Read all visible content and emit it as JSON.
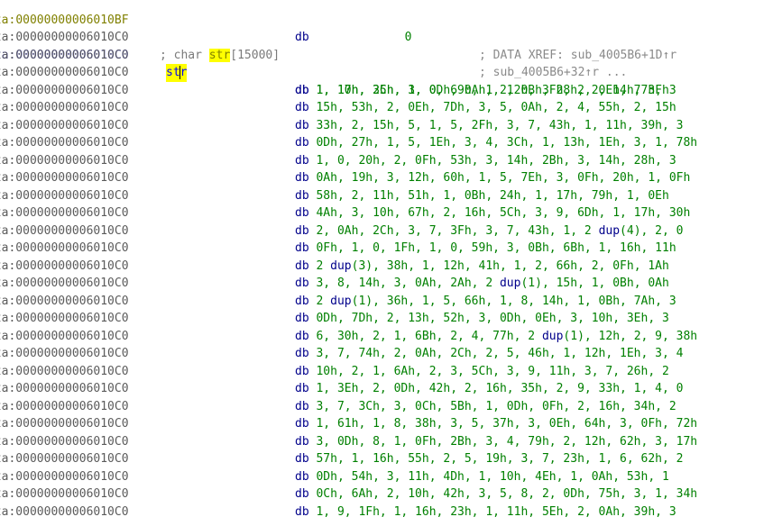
{
  "prefix": "ata:",
  "top_line": {
    "address": "00000000006010BF",
    "mnemonic": "db",
    "operands": "0"
  },
  "comment_line": {
    "address": "00000000006010C0",
    "pre": "; char ",
    "highlight": "str",
    "post": "[15000]"
  },
  "label_line": {
    "address": "00000000006010C0",
    "label_part1": "st",
    "label_part2": "r",
    "mnemonic": "db",
    "operands": "1, 10h, 25h, 3, 0Dh, 0Ah, 2, 0Bh, 28h, 2, 14h, 3Fh"
  },
  "xref_lines": [
    {
      "address": "00000000006010C0",
      "text": "; DATA XREF: sub_4005B6+1D↑r"
    },
    {
      "address": "00000000006010C0",
      "text": "; sub_4005B6+32↑r ..."
    }
  ],
  "data_lines": [
    {
      "address": "00000000006010C0",
      "mnemonic": "db",
      "operands": "1, 17h, 3Ch, 1, 0, 69h, 1, 12h, 3Fh, 2, 0Eh, 77h, 3"
    },
    {
      "address": "00000000006010C0",
      "mnemonic": "db",
      "operands": "15h, 53h, 2, 0Eh, 7Dh, 3, 5, 0Ah, 2, 4, 55h, 2, 15h"
    },
    {
      "address": "00000000006010C0",
      "mnemonic": "db",
      "operands": "33h, 2, 15h, 5, 1, 5, 2Fh, 3, 7, 43h, 1, 11h, 39h, 3"
    },
    {
      "address": "00000000006010C0",
      "mnemonic": "db",
      "operands": "0Dh, 27h, 1, 5, 1Eh, 3, 4, 3Ch, 1, 13h, 1Eh, 3, 1, 78h"
    },
    {
      "address": "00000000006010C0",
      "mnemonic": "db",
      "operands": "1, 0, 20h, 2, 0Fh, 53h, 3, 14h, 2Bh, 3, 14h, 28h, 3"
    },
    {
      "address": "00000000006010C0",
      "mnemonic": "db",
      "operands": "0Ah, 19h, 3, 12h, 60h, 1, 5, 7Eh, 3, 0Fh, 20h, 1, 0Fh"
    },
    {
      "address": "00000000006010C0",
      "mnemonic": "db",
      "operands": "58h, 2, 11h, 51h, 1, 0Bh, 24h, 1, 17h, 79h, 1, 0Eh"
    },
    {
      "address": "00000000006010C0",
      "mnemonic": "db",
      "operands": "4Ah, 3, 10h, 67h, 2, 16h, 5Ch, 3, 9, 6Dh, 1, 17h, 30h"
    },
    {
      "address": "00000000006010C0",
      "mnemonic": "db",
      "operands": "2, 0Ah, 2Ch, 3, 7, 3Fh, 3, 7, 43h, 1, 2 dup(4), 2, 0"
    },
    {
      "address": "00000000006010C0",
      "mnemonic": "db",
      "operands": "0Fh, 1, 0, 1Fh, 1, 0, 59h, 3, 0Bh, 6Bh, 1, 16h, 11h"
    },
    {
      "address": "00000000006010C0",
      "mnemonic": "db",
      "operands": "2 dup(3), 38h, 1, 12h, 41h, 1, 2, 66h, 2, 0Fh, 1Ah"
    },
    {
      "address": "00000000006010C0",
      "mnemonic": "db",
      "operands": "3, 8, 14h, 3, 0Ah, 2Ah, 2 dup(1), 15h, 1, 0Bh, 0Ah"
    },
    {
      "address": "00000000006010C0",
      "mnemonic": "db",
      "operands": "2 dup(1), 36h, 1, 5, 66h, 1, 8, 14h, 1, 0Bh, 7Ah, 3"
    },
    {
      "address": "00000000006010C0",
      "mnemonic": "db",
      "operands": "0Dh, 7Dh, 2, 13h, 52h, 3, 0Dh, 0Eh, 3, 10h, 3Eh, 3"
    },
    {
      "address": "00000000006010C0",
      "mnemonic": "db",
      "operands": "6, 30h, 2, 1, 6Bh, 2, 4, 77h, 2 dup(1), 12h, 2, 9, 38h"
    },
    {
      "address": "00000000006010C0",
      "mnemonic": "db",
      "operands": "3, 7, 74h, 2, 0Ah, 2Ch, 2, 5, 46h, 1, 12h, 1Eh, 3, 4"
    },
    {
      "address": "00000000006010C0",
      "mnemonic": "db",
      "operands": "10h, 2, 1, 6Ah, 2, 3, 5Ch, 3, 9, 11h, 3, 7, 26h, 2"
    },
    {
      "address": "00000000006010C0",
      "mnemonic": "db",
      "operands": "1, 3Eh, 2, 0Dh, 42h, 2, 16h, 35h, 2, 9, 33h, 1, 4, 0"
    },
    {
      "address": "00000000006010C0",
      "mnemonic": "db",
      "operands": "3, 7, 3Ch, 3, 0Ch, 5Bh, 1, 0Dh, 0Fh, 2, 16h, 34h, 2"
    },
    {
      "address": "00000000006010C0",
      "mnemonic": "db",
      "operands": "1, 61h, 1, 8, 38h, 3, 5, 37h, 3, 0Eh, 64h, 3, 0Fh, 72h"
    },
    {
      "address": "00000000006010C0",
      "mnemonic": "db",
      "operands": "3, 0Dh, 8, 1, 0Fh, 2Bh, 3, 4, 79h, 2, 12h, 62h, 3, 17h"
    },
    {
      "address": "00000000006010C0",
      "mnemonic": "db",
      "operands": "57h, 1, 16h, 55h, 2, 5, 19h, 3, 7, 23h, 1, 6, 62h, 2"
    },
    {
      "address": "00000000006010C0",
      "mnemonic": "db",
      "operands": "0Dh, 54h, 3, 11h, 4Dh, 1, 10h, 4Eh, 1, 0Ah, 53h, 1"
    },
    {
      "address": "00000000006010C0",
      "mnemonic": "db",
      "operands": "0Ch, 6Ah, 2, 10h, 42h, 3, 5, 8, 2, 0Dh, 75h, 3, 1, 34h"
    },
    {
      "address": "00000000006010C0",
      "mnemonic": "db",
      "operands": "1, 9, 1Fh, 1, 16h, 23h, 1, 11h, 5Eh, 2, 0Ah, 39h, 3"
    }
  ],
  "colors": {
    "address": "#5b5b5b",
    "address_current": "#0000ff",
    "mnemonic": "#00008b",
    "operands": "#008000",
    "comment": "#7a7a7a",
    "highlight": "#ffff00"
  }
}
